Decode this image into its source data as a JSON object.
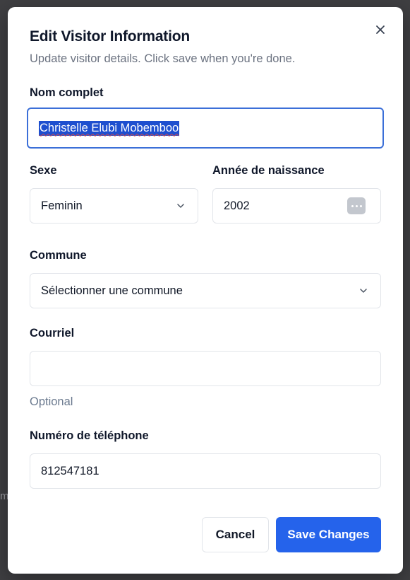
{
  "backdrop": {
    "edge_text": "m"
  },
  "dialog": {
    "title": "Edit Visitor Information",
    "subtitle": "Update visitor details. Click save when you're done.",
    "close_icon": "close-icon"
  },
  "form": {
    "full_name": {
      "label": "Nom complet",
      "value": "Christelle Elubi Mobemboo",
      "selected": true
    },
    "sex": {
      "label": "Sexe",
      "value": "Feminin"
    },
    "birth_year": {
      "label": "Année de naissance",
      "value": "2002",
      "picker_icon": "more-horizontal-icon"
    },
    "commune": {
      "label": "Commune",
      "placeholder": "Sélectionner une commune"
    },
    "email": {
      "label": "Courriel",
      "value": "",
      "helper": "Optional"
    },
    "phone": {
      "label": "Numéro de téléphone",
      "value": "812547181"
    }
  },
  "actions": {
    "cancel_label": "Cancel",
    "save_label": "Save Changes"
  },
  "colors": {
    "primary": "#2563eb",
    "focus_ring": "#3b6fd8",
    "selection": "#1e4fcf",
    "muted_text": "#6b7280",
    "overlay": "#3f3f42"
  }
}
